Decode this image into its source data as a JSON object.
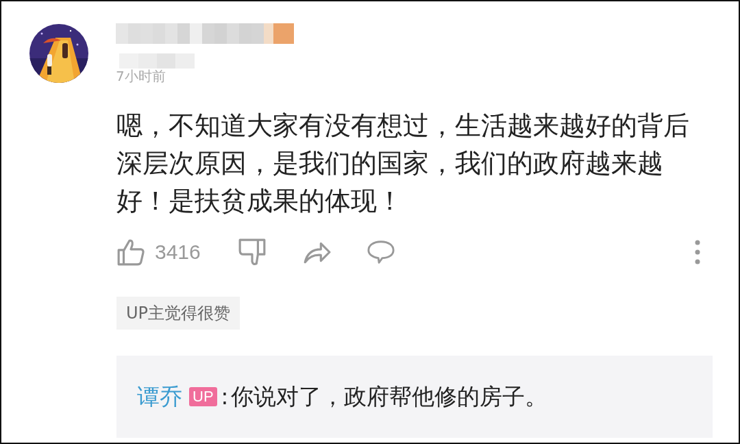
{
  "comment": {
    "time": "7小时前",
    "text": "嗯，不知道大家有没有想过，生活越来越好的背后深层次原因，是我们的国家，我们的政府越来越好！是扶贫成果的体现！",
    "likes": "3416",
    "up_liked": "UP主觉得很赞"
  },
  "reply": {
    "author": "谭乔",
    "badge": "UP",
    "separator": ":",
    "text": "你说对了，政府帮他修的房子。"
  }
}
